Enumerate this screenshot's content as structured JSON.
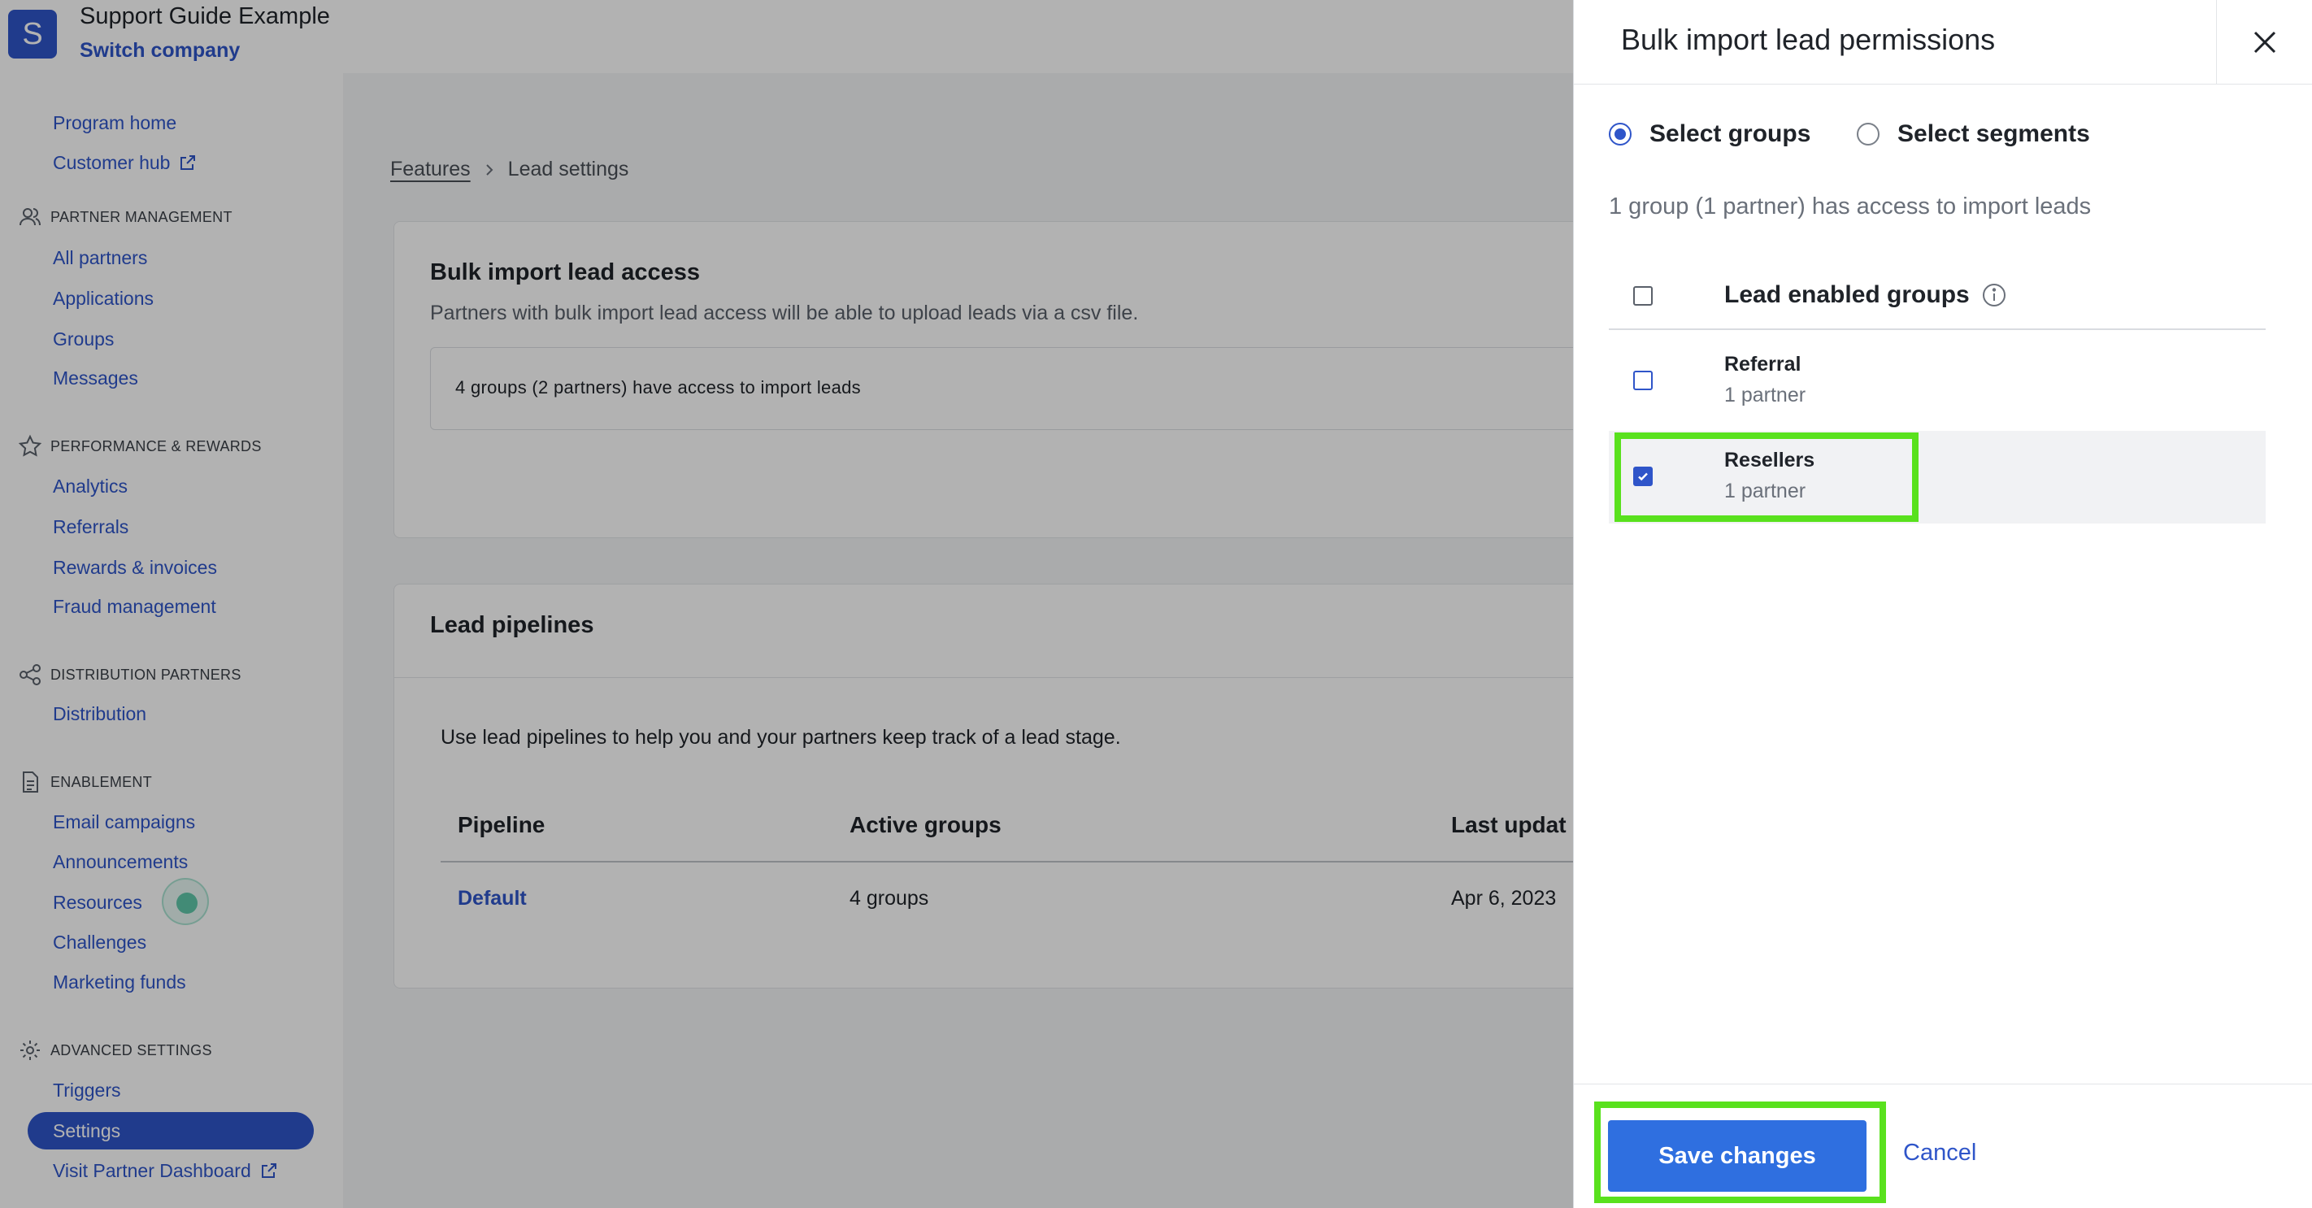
{
  "header": {
    "logo_letter": "S",
    "company_name": "Support Guide Example",
    "switch_company": "Switch company"
  },
  "sidebar": {
    "top_items": [
      {
        "label": "Program home"
      },
      {
        "label": "Customer hub",
        "icon": "external-link-icon"
      }
    ],
    "sections": {
      "partner_management": {
        "title": "PARTNER MANAGEMENT",
        "icon": "users-icon",
        "items": [
          "All partners",
          "Applications",
          "Groups",
          "Messages"
        ]
      },
      "performance": {
        "title": "PERFORMANCE & REWARDS",
        "icon": "star-icon",
        "items": [
          "Analytics",
          "Referrals",
          "Rewards & invoices",
          "Fraud management"
        ]
      },
      "distribution": {
        "title": "DISTRIBUTION PARTNERS",
        "icon": "share-icon",
        "items": [
          "Distribution"
        ]
      },
      "enablement": {
        "title": "ENABLEMENT",
        "icon": "document-icon",
        "items": [
          "Email campaigns",
          "Announcements",
          "Resources",
          "Challenges",
          "Marketing funds"
        ]
      },
      "advanced": {
        "title": "ADVANCED SETTINGS",
        "icon": "gear-icon",
        "items": [
          "Triggers",
          "Settings",
          "Visit Partner Dashboard"
        ]
      }
    },
    "active_item": "Settings"
  },
  "main": {
    "breadcrumb": {
      "parent": "Features",
      "current": "Lead settings"
    },
    "bulk_card": {
      "title": "Bulk import lead access",
      "description": "Partners with bulk import lead access will be able to upload leads via a csv file.",
      "access_summary": "4 groups (2 partners) have access to import leads"
    },
    "pipelines_card": {
      "title": "Lead pipelines",
      "description": "Use lead pipelines to help you and your partners keep track of a lead stage.",
      "columns": [
        "Pipeline",
        "Active groups",
        "Last updat"
      ],
      "rows": [
        {
          "pipeline": "Default",
          "active_groups": "4 groups",
          "last_updated": "Apr 6, 2023"
        }
      ]
    }
  },
  "drawer": {
    "title": "Bulk import lead permissions",
    "radio_options": [
      {
        "label": "Select groups",
        "selected": true
      },
      {
        "label": "Select segments",
        "selected": false
      }
    ],
    "summary": "1 group (1 partner) has access to import leads",
    "groups_header": "Lead enabled groups",
    "groups": [
      {
        "name": "Referral",
        "count": "1 partner",
        "checked": false
      },
      {
        "name": "Resellers",
        "count": "1 partner",
        "checked": true
      }
    ],
    "save_label": "Save changes",
    "cancel_label": "Cancel"
  },
  "colors": {
    "accent": "#2f55c9",
    "button": "#2f6fe0",
    "highlight": "#59e11d"
  }
}
